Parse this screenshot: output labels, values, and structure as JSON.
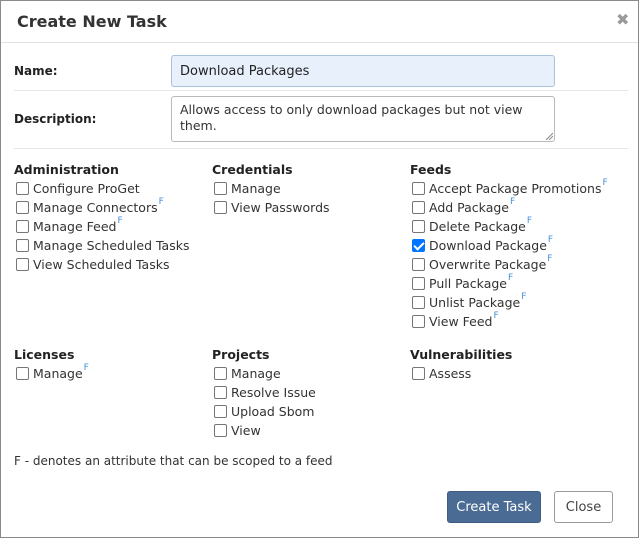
{
  "dialog": {
    "title": "Create New Task",
    "close_glyph": "✖"
  },
  "form": {
    "name_label": "Name:",
    "name_value": "Download Packages",
    "description_label": "Description:",
    "description_value": "Allows access to only download packages but not view them."
  },
  "groups": {
    "administration": {
      "title": "Administration",
      "items": [
        {
          "label": "Configure ProGet",
          "checked": false,
          "feed": false
        },
        {
          "label": "Manage Connectors",
          "checked": false,
          "feed": true
        },
        {
          "label": "Manage Feed",
          "checked": false,
          "feed": true
        },
        {
          "label": "Manage Scheduled Tasks",
          "checked": false,
          "feed": false
        },
        {
          "label": "View Scheduled Tasks",
          "checked": false,
          "feed": false
        }
      ]
    },
    "credentials": {
      "title": "Credentials",
      "items": [
        {
          "label": "Manage",
          "checked": false,
          "feed": false
        },
        {
          "label": "View Passwords",
          "checked": false,
          "feed": false
        }
      ]
    },
    "feeds": {
      "title": "Feeds",
      "items": [
        {
          "label": "Accept Package Promotions",
          "checked": false,
          "feed": true
        },
        {
          "label": "Add Package",
          "checked": false,
          "feed": true
        },
        {
          "label": "Delete Package",
          "checked": false,
          "feed": true
        },
        {
          "label": "Download Package",
          "checked": true,
          "feed": true
        },
        {
          "label": "Overwrite Package",
          "checked": false,
          "feed": true
        },
        {
          "label": "Pull Package",
          "checked": false,
          "feed": true
        },
        {
          "label": "Unlist Package",
          "checked": false,
          "feed": true
        },
        {
          "label": "View Feed",
          "checked": false,
          "feed": true
        }
      ]
    },
    "licenses": {
      "title": "Licenses",
      "items": [
        {
          "label": "Manage",
          "checked": false,
          "feed": true
        }
      ]
    },
    "projects": {
      "title": "Projects",
      "items": [
        {
          "label": "Manage",
          "checked": false,
          "feed": false
        },
        {
          "label": "Resolve Issue",
          "checked": false,
          "feed": false
        },
        {
          "label": "Upload Sbom",
          "checked": false,
          "feed": false
        },
        {
          "label": "View",
          "checked": false,
          "feed": false
        }
      ]
    },
    "vulnerabilities": {
      "title": "Vulnerabilities",
      "items": [
        {
          "label": "Assess",
          "checked": false,
          "feed": false
        }
      ]
    }
  },
  "feed_marker": "F",
  "footnote": "F - denotes an attribute that can be scoped to a feed",
  "buttons": {
    "create_label": "Create Task",
    "close_label": "Close"
  },
  "colors": {
    "primary_button": "#4a6c94",
    "feed_marker": "#4a90d9",
    "checked": "#0075ff",
    "name_input_bg": "#e8f0fc"
  }
}
